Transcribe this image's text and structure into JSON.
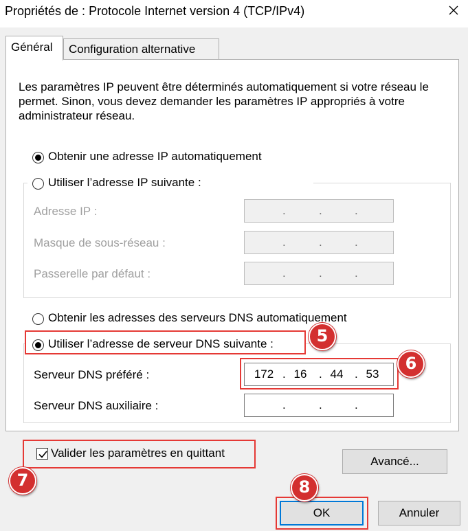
{
  "window": {
    "title": "Propriétés de : Protocole Internet version 4 (TCP/IPv4)"
  },
  "tabs": [
    {
      "label": "Général",
      "active": true
    },
    {
      "label": "Configuration alternative",
      "active": false
    }
  ],
  "description": "Les paramètres IP peuvent être déterminés automatiquement si votre réseau le permet. Sinon, vous devez demander les paramètres IP appropriés à votre administrateur réseau.",
  "ip_section": {
    "auto_label": "Obtenir une adresse IP automatiquement",
    "manual_label": "Utiliser l’adresse IP suivante :",
    "fields": [
      {
        "label": "Adresse IP :"
      },
      {
        "label": "Masque de sous-réseau :"
      },
      {
        "label": "Passerelle par défaut :"
      }
    ]
  },
  "dns_section": {
    "auto_label": "Obtenir les adresses des serveurs DNS automatiquement",
    "manual_label": "Utiliser l’adresse de serveur DNS suivante :",
    "preferred_label": "Serveur DNS préféré :",
    "preferred_value": [
      "172",
      "16",
      "44",
      "53"
    ],
    "alternate_label": "Serveur DNS auxiliaire :"
  },
  "validate_label": "Valider les paramètres en quittant",
  "buttons": {
    "advanced": "Avancé...",
    "ok": "OK",
    "cancel": "Annuler"
  },
  "annotations": [
    "5",
    "6",
    "7",
    "8"
  ],
  "colors": {
    "highlight": "#e53935",
    "badge": "#d32f2f",
    "focus": "#0078d7"
  }
}
